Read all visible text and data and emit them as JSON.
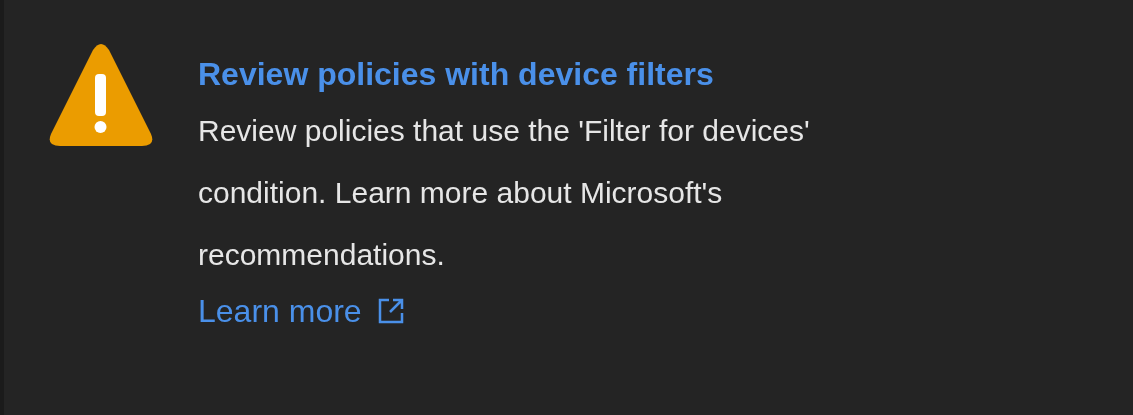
{
  "title": "Review policies with device filters",
  "description": "Review policies that use the 'Filter for devices' condition. Learn more about Microsoft's recommendations.",
  "link": {
    "label": "Learn more"
  }
}
